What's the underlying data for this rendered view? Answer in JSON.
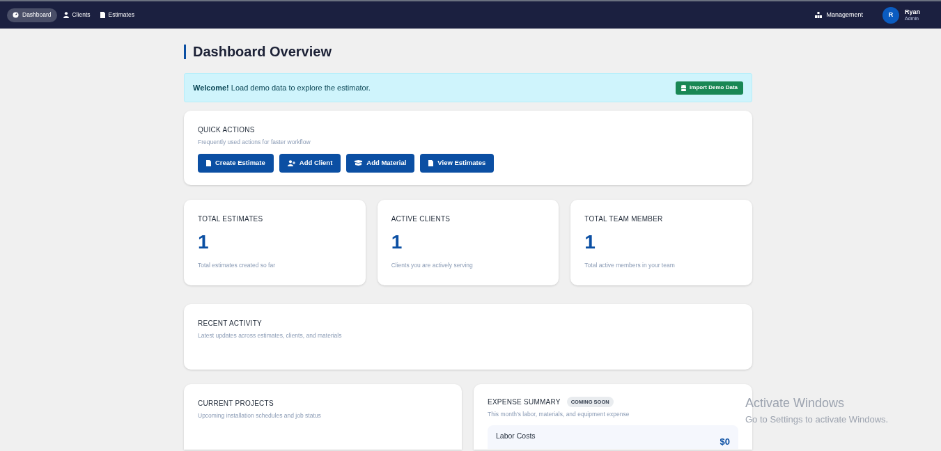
{
  "nav": {
    "items": [
      {
        "label": "Dashboard",
        "kind": "gauge",
        "selected": true
      },
      {
        "label": "Clients",
        "kind": "user",
        "selected": false
      },
      {
        "label": "Estimates",
        "kind": "doc",
        "selected": false
      }
    ],
    "management": {
      "label": "Management"
    },
    "user": {
      "initial": "R",
      "name": "Ryan",
      "role": "Admin"
    }
  },
  "page_title": "Dashboard Overview",
  "alert": {
    "text": "**Welcome!** Load demo data to explore the estimator.",
    "button": "Import Demo Data"
  },
  "quick_actions": {
    "title": "QUICK ACTIONS",
    "subtitle": "Frequently used actions for faster workflow",
    "buttons": [
      {
        "label": "Create Estimate",
        "kind": "doc"
      },
      {
        "label": "Add Client",
        "kind": "user-plus"
      },
      {
        "label": "Add Material",
        "kind": "box"
      },
      {
        "label": "View Estimates",
        "kind": "doc"
      }
    ]
  },
  "stats": [
    {
      "title": "TOTAL ESTIMATES",
      "value": "1",
      "caption": "Total estimates created so far"
    },
    {
      "title": "ACTIVE CLIENTS",
      "value": "1",
      "caption": "Clients you are actively serving"
    },
    {
      "title": "TOTAL TEAM MEMBER",
      "value": "1",
      "caption": "Total active members in your team"
    }
  ],
  "recent_activity": {
    "title": "RECENT ACTIVITY",
    "subtitle": "Latest updates across estimates, clients, and materials"
  },
  "current_projects": {
    "title": "CURRENT PROJECTS",
    "subtitle": "Upcoming installation schedules and job status"
  },
  "expense_summary": {
    "title": "EXPENSE SUMMARY",
    "badge": "COMING SOON",
    "subtitle": "This month's labor, materials, and equipment expense",
    "rows": [
      {
        "label": "Labor Costs",
        "value": "$0"
      }
    ]
  },
  "os_overlay": {
    "title": "Activate Windows",
    "subtitle": "Go to Settings to activate Windows."
  }
}
